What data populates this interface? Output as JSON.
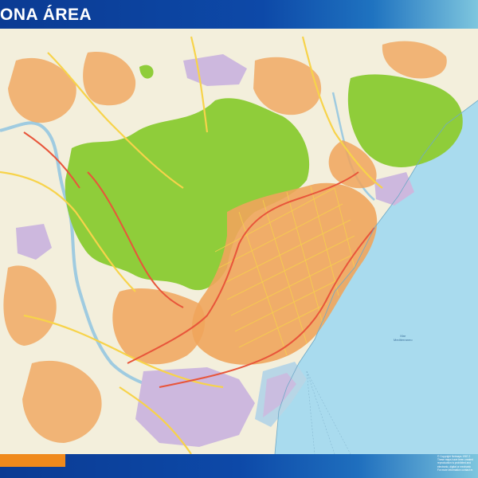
{
  "header": {
    "title": "ONA ÁREA"
  },
  "map": {
    "sea_label": {
      "line1": "Mar",
      "line2": "Mediterraneo"
    }
  },
  "footer": {
    "copyright_lines": [
      "© Copyright Netmaps 1987-2",
      "These maps have been created",
      "reproduction is prohibited and",
      "electronic, digital or mechanic",
      "For more information contact m"
    ]
  },
  "colors": {
    "header_blue": "#0d49a8",
    "sea": "#a9dbee",
    "park_green": "#8fcd3a",
    "urban_orange": "#f0a55c",
    "industrial_purple": "#cdb8de",
    "road_yellow": "#f7d34a",
    "highway_red": "#e8553a",
    "background_land": "#f3efdc",
    "footer_tab_orange": "#f08a1c"
  }
}
